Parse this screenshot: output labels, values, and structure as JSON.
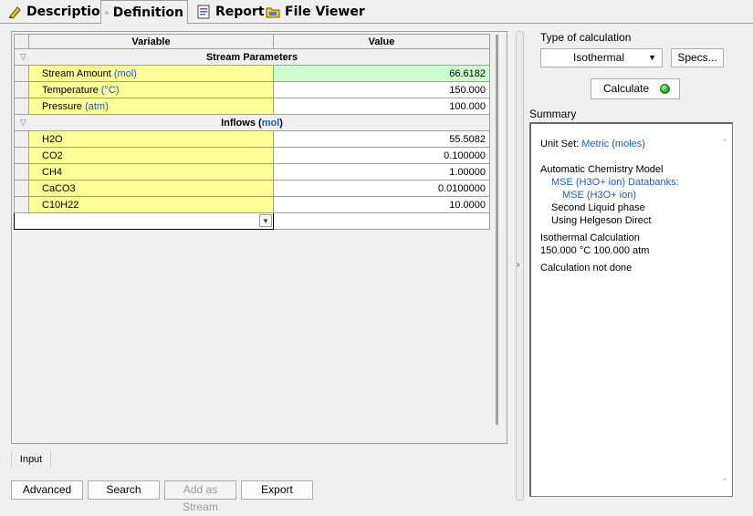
{
  "tabs": [
    {
      "label": "Description",
      "icon": "pencil-icon",
      "active": false
    },
    {
      "label": "Definition",
      "icon": "definition-icon",
      "active": true
    },
    {
      "label": "Report",
      "icon": "report-icon",
      "active": false
    },
    {
      "label": "File Viewer",
      "icon": "file-viewer-icon",
      "active": false
    }
  ],
  "grid": {
    "headers": {
      "variable": "Variable",
      "value": "Value"
    },
    "sections": [
      {
        "title": "Stream Parameters",
        "title_unit": "",
        "rows": [
          {
            "name": "Stream Amount",
            "unit": "(mol)",
            "value": "66.6182"
          },
          {
            "name": "Temperature",
            "unit": "(°C)",
            "value": "150.000"
          },
          {
            "name": "Pressure",
            "unit": "(atm)",
            "value": "100.000"
          }
        ]
      },
      {
        "title": "Inflows",
        "title_unit": "mol",
        "rows": [
          {
            "name": "H2O",
            "unit": "",
            "value": "55.5082"
          },
          {
            "name": "CO2",
            "unit": "",
            "value": "0.100000"
          },
          {
            "name": "CH4",
            "unit": "",
            "value": "1.00000"
          },
          {
            "name": "CaCO3",
            "unit": "",
            "value": "0.0100000"
          },
          {
            "name": "C10H22",
            "unit": "",
            "value": "10.0000"
          }
        ]
      }
    ]
  },
  "bottom_tab": "Input",
  "buttons": {
    "advanced": "Advanced",
    "search": "Search",
    "add_as_stream": "Add as Stream",
    "export": "Export"
  },
  "right": {
    "type_label": "Type of calculation",
    "type_value": "Isothermal",
    "specs": "Specs...",
    "calculate": "Calculate",
    "summary_label": "Summary",
    "summary": {
      "unit_set_label": "Unit Set:",
      "unit_set_value": "Metric (moles)",
      "model": "Automatic Chemistry Model",
      "databanks": "MSE (H3O+ ion) Databanks:",
      "databank_item": "MSE (H3O+ ion)",
      "liquid": "Second Liquid phase",
      "helgeson": "Using Helgeson Direct",
      "calc_type": "Isothermal Calculation",
      "conditions": "150.000 °C 100.000 atm",
      "status": "Calculation not done"
    }
  }
}
